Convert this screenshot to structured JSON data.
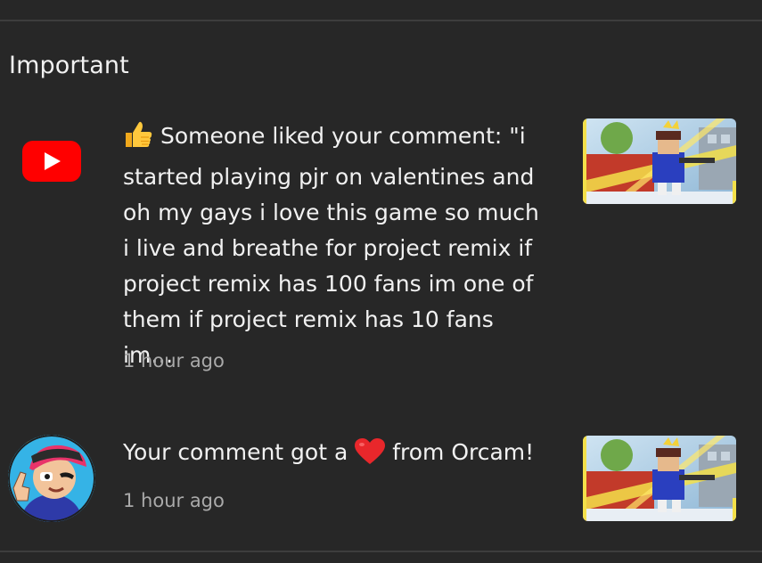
{
  "section": {
    "title": "Important"
  },
  "notifications": [
    {
      "icon": "youtube-logo-icon",
      "emoji": "thumbs-up-icon",
      "text": "Someone liked your comment: \"i started playing pjr on valentines and oh my gays i love this game so much i live and breathe for project remix if project remix has 100 fans im one of them if project remix has 10 fans im…",
      "time": "1 hour ago"
    },
    {
      "icon": "channel-avatar",
      "text_before": "Your comment got a",
      "emoji": "heart-icon",
      "text_after": "from Orcam!",
      "time": "1 hour ago"
    }
  ],
  "colors": {
    "background": "#272727",
    "text": "#f1f1f1",
    "secondary_text": "#aaaaaa",
    "youtube_red": "#ff0000",
    "heart_red": "#e8272b",
    "thumbs_yellow": "#ffc83d"
  }
}
